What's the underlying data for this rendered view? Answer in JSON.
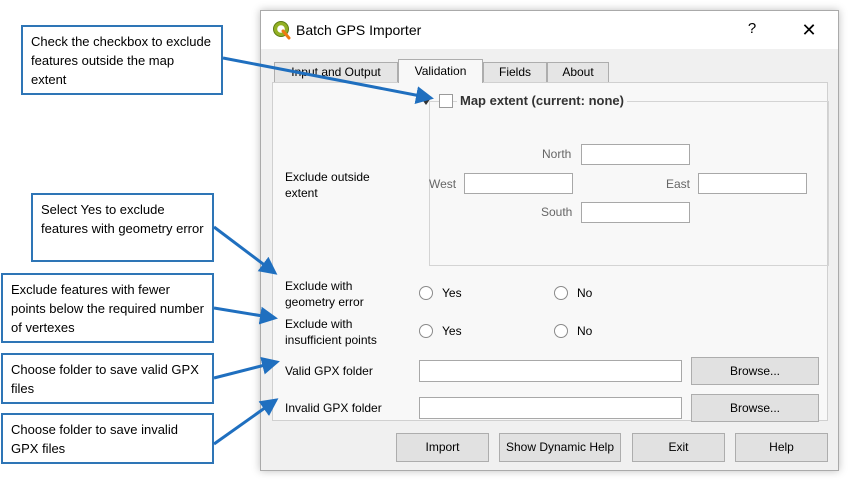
{
  "window": {
    "title": "Batch GPS Importer",
    "help_label": "?",
    "close_label": "✕",
    "icon": "qgis-logo-icon"
  },
  "tabs": [
    {
      "label": "Input and Output",
      "active": false
    },
    {
      "label": "Validation",
      "active": true
    },
    {
      "label": "Fields",
      "active": false
    },
    {
      "label": "About",
      "active": false
    }
  ],
  "validation": {
    "extent_label": "Exclude outside extent",
    "map_extent_label": "Map extent (current: none)",
    "map_extent_checked": false,
    "north_label": "North",
    "west_label": "West",
    "east_label": "East",
    "south_label": "South",
    "north_value": "",
    "west_value": "",
    "east_value": "",
    "south_value": "",
    "geometry_error_label": "Exclude with geometry error",
    "insufficient_points_label": "Exclude with insufficient points",
    "yes_label": "Yes",
    "no_label": "No",
    "valid_folder_label": "Valid GPX folder",
    "invalid_folder_label": "Invalid GPX folder",
    "valid_folder_value": "",
    "invalid_folder_value": "",
    "browse_label": "Browse..."
  },
  "buttons": {
    "import": "Import",
    "dynamic_help": "Show Dynamic Help",
    "exit": "Exit",
    "help": "Help"
  },
  "callouts": {
    "extent": "Check the checkbox to exclude features outside the map extent",
    "geometry": "Select Yes to exclude features with geometry error",
    "points": "Exclude features with fewer points below the required number of vertexes",
    "valid": "Choose folder to save valid GPX files",
    "invalid": "Choose folder to save invalid GPX files"
  },
  "colors": {
    "callout_border": "#2e75b6",
    "arrow": "#1f6fbf"
  }
}
